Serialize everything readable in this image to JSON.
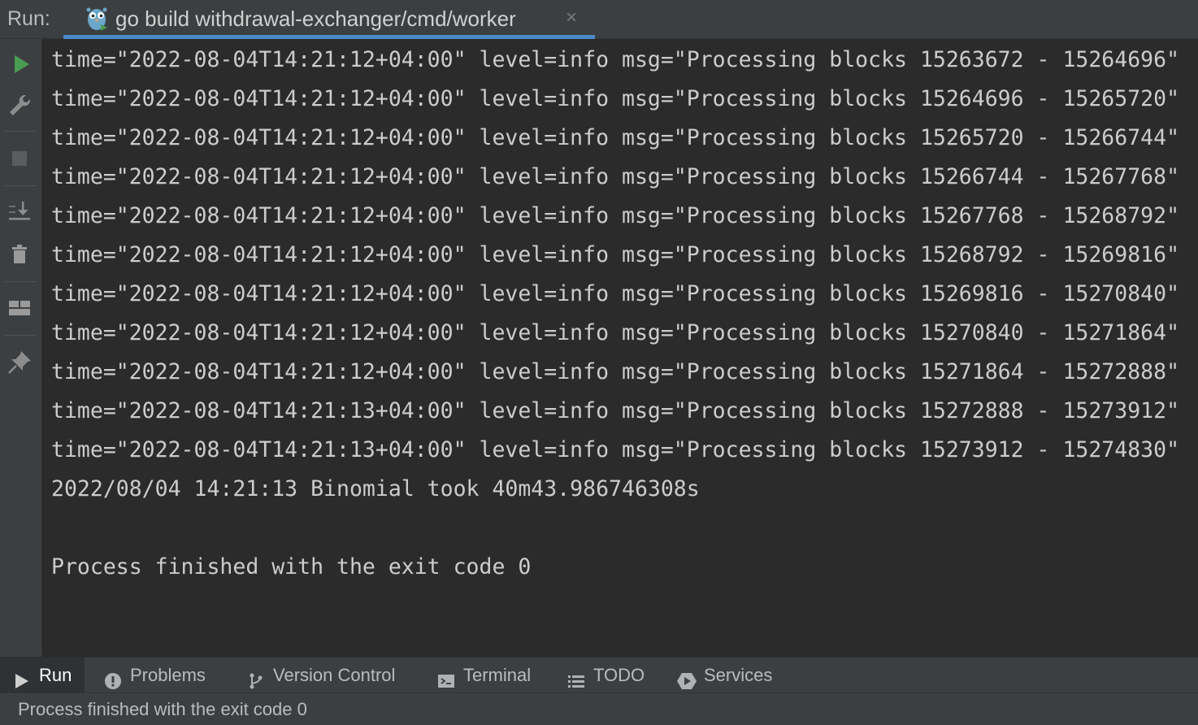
{
  "header": {
    "run_label": "Run:",
    "tab_title": "go build withdrawal-exchanger/cmd/worker",
    "tab_icon": "gopher-icon",
    "close_symbol": "×"
  },
  "toolbar": {
    "items": [
      {
        "name": "rerun-icon",
        "tooltip": ""
      },
      {
        "name": "wrench-icon",
        "tooltip": ""
      },
      {
        "name": "stop-icon",
        "tooltip": ""
      },
      {
        "name": "scroll-to-end-icon",
        "tooltip": ""
      },
      {
        "name": "trash-icon",
        "tooltip": ""
      },
      {
        "name": "layout-icon",
        "tooltip": ""
      },
      {
        "name": "pin-icon",
        "tooltip": ""
      }
    ]
  },
  "console": {
    "lines": [
      "time=\"2022-08-04T14:21:12+04:00\" level=info msg=\"Processing blocks 15263672 - 15264696\"",
      "time=\"2022-08-04T14:21:12+04:00\" level=info msg=\"Processing blocks 15264696 - 15265720\"",
      "time=\"2022-08-04T14:21:12+04:00\" level=info msg=\"Processing blocks 15265720 - 15266744\"",
      "time=\"2022-08-04T14:21:12+04:00\" level=info msg=\"Processing blocks 15266744 - 15267768\"",
      "time=\"2022-08-04T14:21:12+04:00\" level=info msg=\"Processing blocks 15267768 - 15268792\"",
      "time=\"2022-08-04T14:21:12+04:00\" level=info msg=\"Processing blocks 15268792 - 15269816\"",
      "time=\"2022-08-04T14:21:12+04:00\" level=info msg=\"Processing blocks 15269816 - 15270840\"",
      "time=\"2022-08-04T14:21:12+04:00\" level=info msg=\"Processing blocks 15270840 - 15271864\"",
      "time=\"2022-08-04T14:21:12+04:00\" level=info msg=\"Processing blocks 15271864 - 15272888\"",
      "time=\"2022-08-04T14:21:13+04:00\" level=info msg=\"Processing blocks 15272888 - 15273912\"",
      "time=\"2022-08-04T14:21:13+04:00\" level=info msg=\"Processing blocks 15273912 - 15274830\"",
      "2022/08/04 14:21:13 Binomial took 40m43.986746308s",
      "",
      "Process finished with the exit code 0"
    ]
  },
  "bottom_tabs": [
    {
      "label": "Run",
      "icon": "play-icon",
      "active": true
    },
    {
      "label": "Problems",
      "icon": "problems-icon",
      "active": false
    },
    {
      "label": "Version Control",
      "icon": "branch-icon",
      "active": false
    },
    {
      "label": "Terminal",
      "icon": "terminal-icon",
      "active": false
    },
    {
      "label": "TODO",
      "icon": "list-icon",
      "active": false
    },
    {
      "label": "Services",
      "icon": "services-icon",
      "active": false
    }
  ],
  "status_bar": {
    "text": "Process finished with the exit code 0"
  },
  "colors": {
    "accent": "#4a88c7",
    "run_green": "#499c54",
    "console_bg": "#2b2b2b",
    "panel_bg": "#3c3f41",
    "text": "#cccccc"
  }
}
